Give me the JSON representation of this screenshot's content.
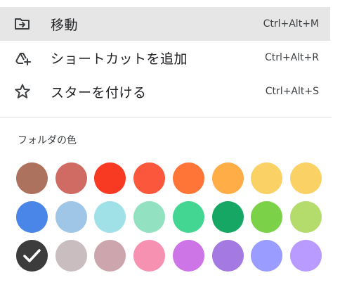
{
  "menu": {
    "items": [
      {
        "label": "移動",
        "shortcut": "Ctrl+Alt+M",
        "icon": "move-folder-icon"
      },
      {
        "label": "ショートカットを追加",
        "shortcut": "Ctrl+Alt+R",
        "icon": "add-shortcut-icon"
      },
      {
        "label": "スターを付ける",
        "shortcut": "Ctrl+Alt+S",
        "icon": "star-outline-icon"
      }
    ]
  },
  "folder_color": {
    "title": "フォルダの色",
    "selected": "#3c3c3c",
    "rows": [
      [
        "#ac725e",
        "#d06b64",
        "#f83a22",
        "#fa573c",
        "#ff7537",
        "#ffad46",
        "#fad165",
        "#fad165"
      ],
      [
        "#4986e7",
        "#9fc6e7",
        "#9fe1e7",
        "#92e1c0",
        "#42d692",
        "#16a765",
        "#7bd148",
        "#b3dc6c"
      ],
      [
        "#3c3c3c",
        "#cabdbf",
        "#cca6ac",
        "#f691b2",
        "#cd74e6",
        "#a47ae2",
        "#9a9cff",
        "#b99aff"
      ]
    ]
  }
}
